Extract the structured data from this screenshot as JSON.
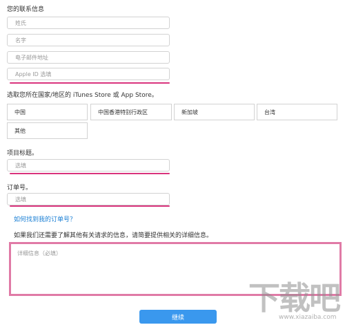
{
  "contact": {
    "heading": "您的联系信息",
    "last_name_placeholder": "姓氏",
    "first_name_placeholder": "名字",
    "email_placeholder": "电子邮件地址",
    "apple_id_placeholder": "Apple ID 选填"
  },
  "store": {
    "prompt": "选取您所在国家/地区的 iTunes Store 或 App Store。",
    "countries": [
      "中国",
      "中国香港特别行政区",
      "新加坡",
      "台湾",
      "其他"
    ]
  },
  "project": {
    "label": "项目标题。",
    "placeholder": "选填"
  },
  "order": {
    "label": "订单号。",
    "placeholder": "选填",
    "help_link": "如何找到我的订单号？"
  },
  "details": {
    "prompt": "如果我们还需要了解其他有关请求的信息，请简要提供相关的详细信息。",
    "placeholder": "详细信息（必填）"
  },
  "continue_button": "继续",
  "watermark": {
    "logo_text": "下载吧",
    "url": "www.xiazaiba.com"
  },
  "colors": {
    "highlight": "#d9337c",
    "button": "#3a98ee",
    "link": "#1a7fd4"
  }
}
